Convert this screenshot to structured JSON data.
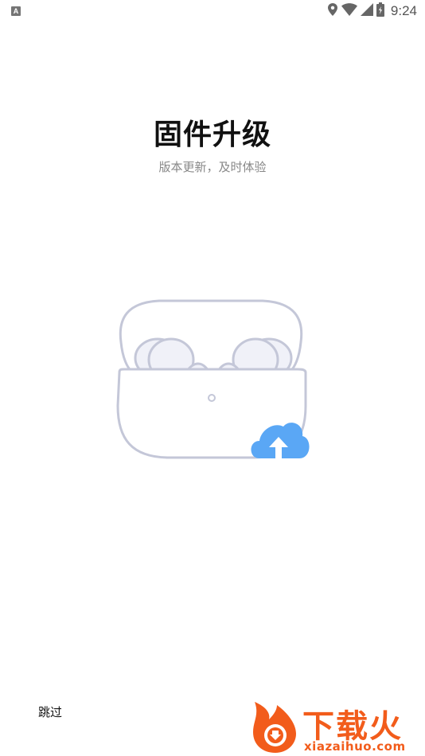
{
  "status_bar": {
    "left_icon_letter": "A",
    "time": "9:24",
    "icons": [
      "location-icon",
      "wifi-icon",
      "signal-icon",
      "battery-icon"
    ]
  },
  "page": {
    "title": "固件升级",
    "subtitle": "版本更新，及时体验"
  },
  "illustration": {
    "name": "earbuds-case-upload",
    "accent_color": "#5aa7f5",
    "outline_color": "#c4c7d8"
  },
  "footer": {
    "skip_label": "跳过"
  },
  "watermark": {
    "text": "下载火",
    "url": "xiazaihuo.com",
    "color": "#f25c1b"
  }
}
